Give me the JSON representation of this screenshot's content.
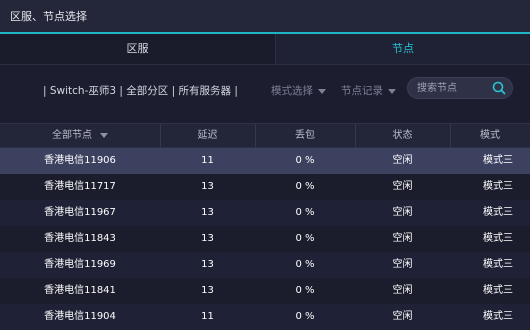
{
  "window": {
    "title": "区服、节点选择"
  },
  "tabs": [
    {
      "label": "区服",
      "active": false
    },
    {
      "label": "节点",
      "active": true
    }
  ],
  "toolbar": {
    "filter_text": "| Switch-巫师3 | 全部分区 | 所有服务器 |",
    "mode_dropdown": "模式选择",
    "record_dropdown": "节点记录",
    "search_placeholder": "搜索节点",
    "search_value": ""
  },
  "table": {
    "headers": [
      "全部节点",
      "延迟",
      "丢包",
      "状态",
      "模式"
    ],
    "rows": [
      {
        "node": "香港电信11906",
        "delay": "11",
        "loss": "0 %",
        "status": "空闲",
        "mode": "模式三"
      },
      {
        "node": "香港电信11717",
        "delay": "13",
        "loss": "0 %",
        "status": "空闲",
        "mode": "模式三"
      },
      {
        "node": "香港电信11967",
        "delay": "13",
        "loss": "0 %",
        "status": "空闲",
        "mode": "模式三"
      },
      {
        "node": "香港电信11843",
        "delay": "13",
        "loss": "0 %",
        "status": "空闲",
        "mode": "模式三"
      },
      {
        "node": "香港电信11969",
        "delay": "13",
        "loss": "0 %",
        "status": "空闲",
        "mode": "模式三"
      },
      {
        "node": "香港电信11841",
        "delay": "13",
        "loss": "0 %",
        "status": "空闲",
        "mode": "模式三"
      },
      {
        "node": "香港电信11904",
        "delay": "11",
        "loss": "0 %",
        "status": "空闲",
        "mode": "模式三"
      }
    ]
  },
  "colors": {
    "accent": "#1eb6c6",
    "selected_row": "#3c4160",
    "background": "#1b1d2d"
  }
}
